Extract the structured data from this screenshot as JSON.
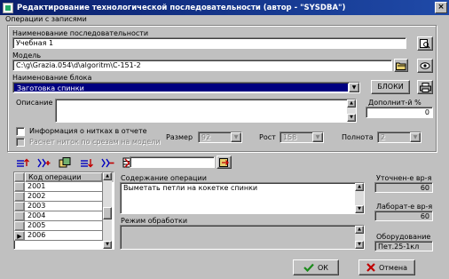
{
  "window": {
    "title": "Редактирование технологической последовательности (автор - \"SYSDBA\")",
    "close_symbol": "×"
  },
  "menu": {
    "records_label": "Операции с записями"
  },
  "sequence": {
    "name_label": "Наименование последовательности",
    "name_value": "Учебная 1"
  },
  "model": {
    "label": "Модель",
    "value": "C:\\g\\Grazia.054\\d\\algoritm\\C-151-2"
  },
  "block": {
    "label": "Наименование блока",
    "value": "Заготовка спинки",
    "blocks_button": "БЛОКИ"
  },
  "description": {
    "label": "Описание",
    "value": "",
    "extra_label": "Дополнит-й %",
    "extra_value": "0"
  },
  "options": {
    "threads_info_label": "Информация о нитках в отчете",
    "threads_calc_label": "Расчет ниток по срезам на модели",
    "size_label": "Размер",
    "size_value": "92",
    "height_label": "Рост",
    "height_value": "158",
    "fullness_label": "Полнота",
    "fullness_value": "2"
  },
  "toolbar": {
    "icons": [
      "add-row-icon",
      "insert-row-icon",
      "copy-icon",
      "move-icon",
      "delete-row-icon",
      "clear-icon"
    ],
    "search_value": ""
  },
  "operations": {
    "column_header": "Код операции",
    "rows": [
      "2001",
      "2002",
      "2003",
      "2004",
      "2005",
      "2006"
    ],
    "current_row_marker": "▶"
  },
  "operation_content": {
    "label": "Содержание операции",
    "value": "Выметать петли на кокетке спинки"
  },
  "processing_mode": {
    "label": "Режим обработки",
    "value": ""
  },
  "refined_time": {
    "label": "Уточнен-е вр-я",
    "value": "60"
  },
  "lab_time": {
    "label": "Лаборат-е вр-я",
    "value": "60"
  },
  "equipment": {
    "label": "Оборудование",
    "value": "Пет.25-1кл"
  },
  "buttons": {
    "ok_label": "ОК",
    "cancel_label": "Отмена"
  },
  "colors": {
    "titlebar_start": "#0a1f6c",
    "titlebar_end": "#1f4aa8",
    "selection": "#000080",
    "ok_check": "#1a8a1a",
    "cancel_x": "#c00000"
  }
}
